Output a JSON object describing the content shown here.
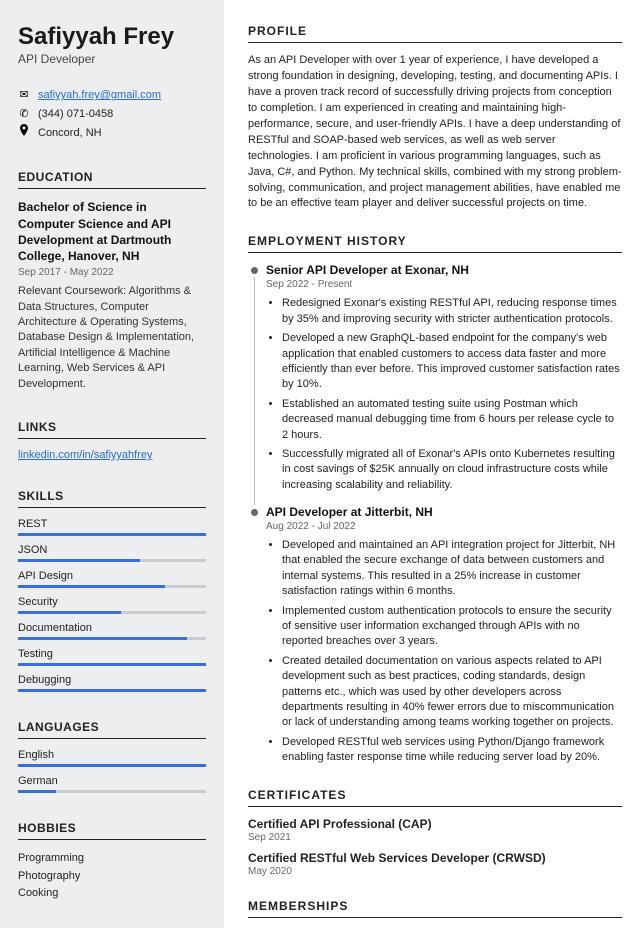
{
  "name": "Safiyyah Frey",
  "title": "API Developer",
  "contact": {
    "email": "safiyyah.frey@gmail.com",
    "phone": "(344) 071-0458",
    "location": "Concord, NH"
  },
  "sections": {
    "education": "EDUCATION",
    "links": "LINKS",
    "skills": "SKILLS",
    "languages": "LANGUAGES",
    "hobbies": "HOBBIES",
    "profile": "PROFILE",
    "employment": "EMPLOYMENT HISTORY",
    "certificates": "CERTIFICATES",
    "memberships": "MEMBERSHIPS"
  },
  "education": {
    "degree": "Bachelor of Science in Computer Science and API Development at Dartmouth College, Hanover, NH",
    "dates": "Sep 2017 - May 2022",
    "desc": "Relevant Coursework: Algorithms & Data Structures, Computer Architecture & Operating Systems, Database Design & Implementation, Artificial Intelligence & Machine Learning, Web Services & API Development."
  },
  "links": {
    "linkedin": "linkedin.com/in/safiyyahfrey"
  },
  "skills": [
    {
      "name": "REST",
      "pct": 100
    },
    {
      "name": "JSON",
      "pct": 65
    },
    {
      "name": "API Design",
      "pct": 78
    },
    {
      "name": "Security",
      "pct": 55
    },
    {
      "name": "Documentation",
      "pct": 90
    },
    {
      "name": "Testing",
      "pct": 100
    },
    {
      "name": "Debugging",
      "pct": 100
    }
  ],
  "languages": [
    {
      "name": "English",
      "pct": 100
    },
    {
      "name": "German",
      "pct": 20
    }
  ],
  "hobbies": [
    "Programming",
    "Photography",
    "Cooking"
  ],
  "profile": "As an API Developer with over 1 year of experience, I have developed a strong foundation in designing, developing, testing, and documenting APIs. I have a proven track record of successfully driving projects from conception to completion. I am experienced in creating and maintaining high-performance, secure, and user-friendly APIs. I have a deep understanding of RESTful and SOAP-based web services, as well as web server technologies. I am proficient in various programming languages, such as Java, C#, and Python. My technical skills, combined with my strong problem-solving, communication, and project management abilities, have enabled me to be an effective team player and deliver successful projects on time.",
  "jobs": [
    {
      "title": "Senior API Developer at Exonar, NH",
      "dates": "Sep 2022 - Present",
      "bullets": [
        "Redesigned Exonar's existing RESTful API, reducing response times by 35% and improving security with stricter authentication protocols.",
        "Developed a new GraphQL-based endpoint for the company's web application that enabled customers to access data faster and more efficiently than ever before. This improved customer satisfaction rates by 10%.",
        "Established an automated testing suite using Postman which decreased manual debugging time from 6 hours per release cycle to 2 hours.",
        "Successfully migrated all of Exonar's APIs onto Kubernetes resulting in cost savings of $25K annually on cloud infrastructure costs while increasing scalability and reliability."
      ]
    },
    {
      "title": "API Developer at Jitterbit, NH",
      "dates": "Aug 2022 - Jul 2022",
      "bullets": [
        "Developed and maintained an API integration project for Jitterbit, NH that enabled the secure exchange of data between customers and internal systems. This resulted in a 25% increase in customer satisfaction ratings within 6 months.",
        "Implemented custom authentication protocols to ensure the security of sensitive user information exchanged through APIs with no reported breaches over 3 years.",
        "Created detailed documentation on various aspects related to API development such as best practices, coding standards, design patterns etc., which was used by other developers across departments resulting in 40% fewer errors due to miscommunication or lack of understanding among teams working together on projects.",
        "Developed RESTful web services using Python/Django framework enabling faster response time while reducing server load by 20%."
      ]
    }
  ],
  "certificates": [
    {
      "title": "Certified API Professional (CAP)",
      "date": "Sep 2021"
    },
    {
      "title": "Certified RESTful Web Services Developer (CRWSD)",
      "date": "May 2020"
    }
  ]
}
